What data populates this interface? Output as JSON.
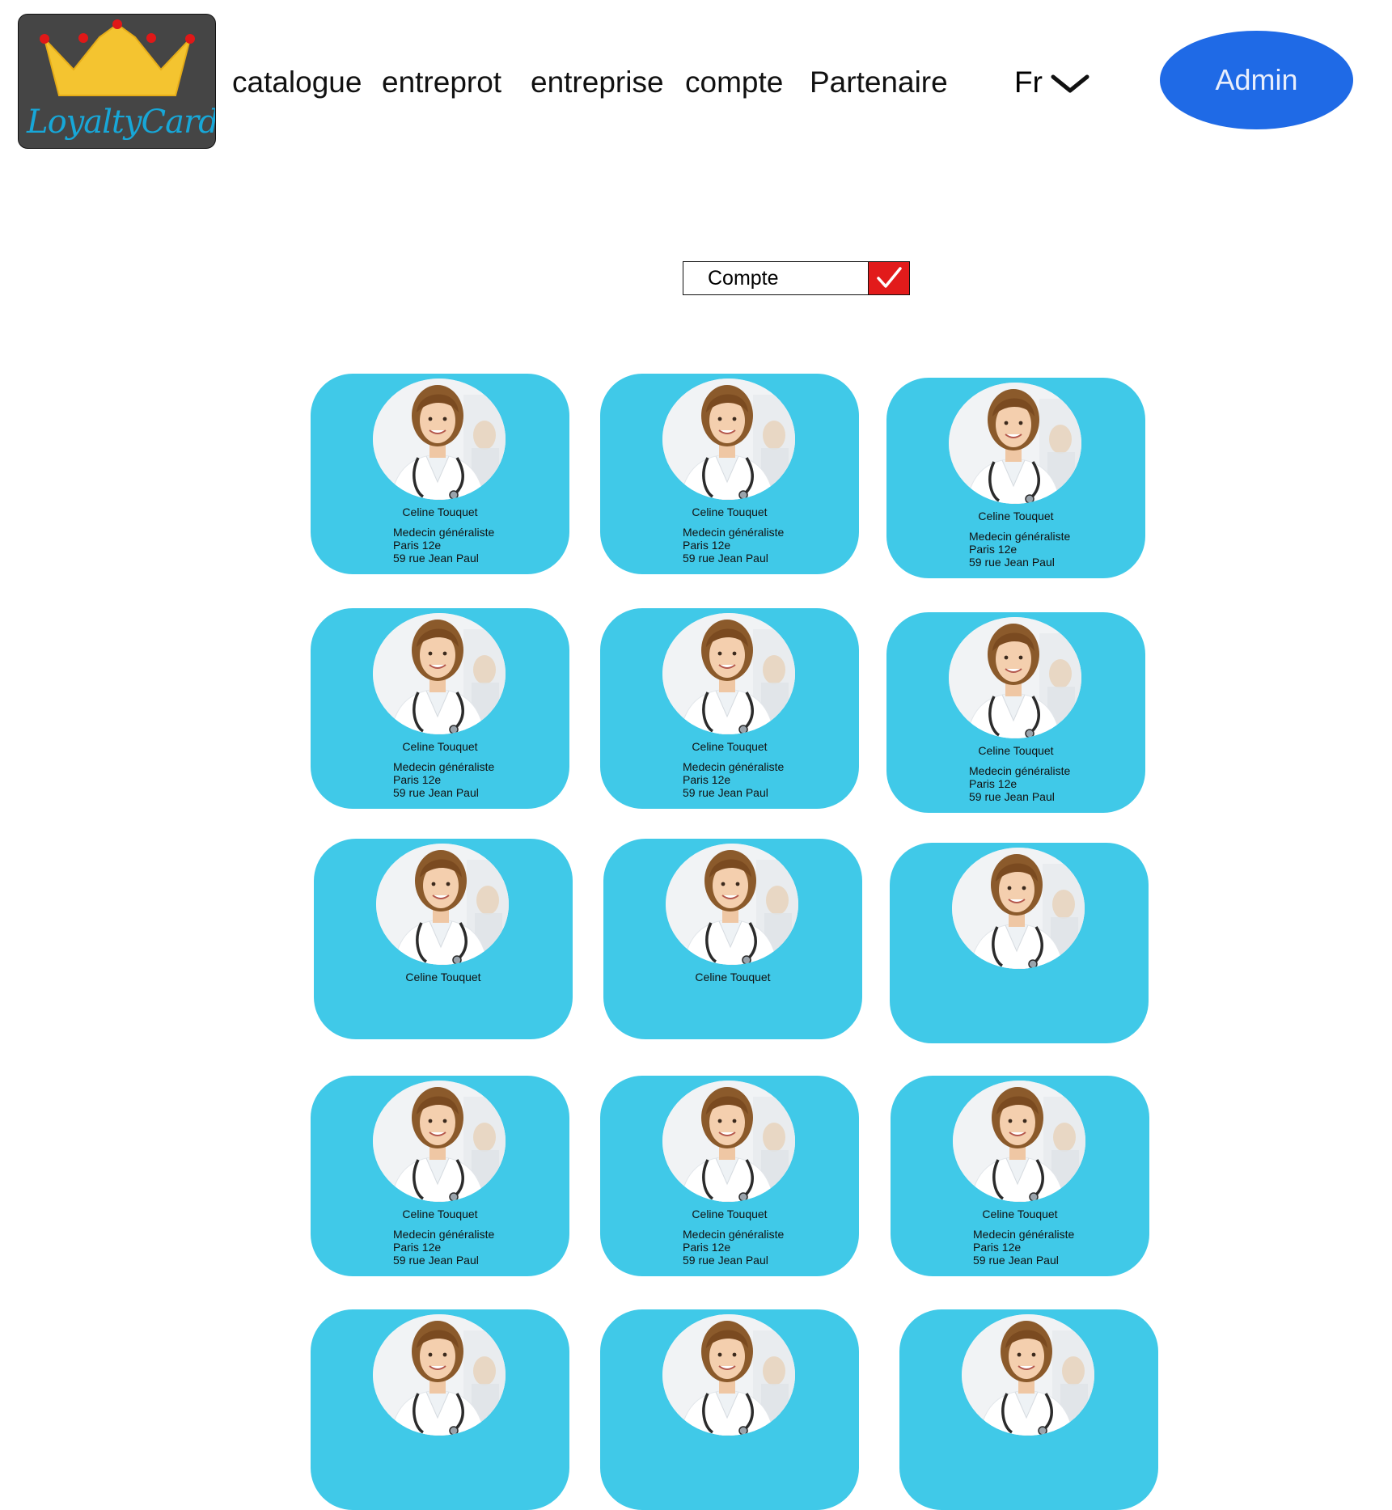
{
  "logo": {
    "text": "LoyaltyCard"
  },
  "nav": {
    "items": [
      {
        "label": "catalogue"
      },
      {
        "label": "entreprot"
      },
      {
        "label": "entreprise"
      },
      {
        "label": "compte"
      },
      {
        "label": "Partenaire"
      }
    ]
  },
  "language": {
    "selected": "Fr"
  },
  "admin_button": {
    "label": "Admin"
  },
  "filter": {
    "value": "Compte"
  },
  "cards": [
    {
      "name": "Celine Touquet",
      "specialty": "Medecin généraliste",
      "city": "Paris 12e",
      "address": "59 rue Jean Paul"
    },
    {
      "name": "Celine Touquet",
      "specialty": "Medecin généraliste",
      "city": "Paris 12e",
      "address": "59 rue Jean Paul"
    },
    {
      "name": "Celine Touquet",
      "specialty": "Medecin généraliste",
      "city": "Paris 12e",
      "address": "59 rue Jean Paul"
    },
    {
      "name": "Celine Touquet",
      "specialty": "Medecin généraliste",
      "city": "Paris 12e",
      "address": "59 rue Jean Paul"
    },
    {
      "name": "Celine Touquet",
      "specialty": "Medecin généraliste",
      "city": "Paris 12e",
      "address": "59 rue Jean Paul"
    },
    {
      "name": "Celine Touquet",
      "specialty": "Medecin généraliste",
      "city": "Paris 12e",
      "address": "59 rue Jean Paul"
    },
    {
      "name": "Celine Touquet",
      "specialty": "",
      "city": "",
      "address": ""
    },
    {
      "name": "Celine Touquet",
      "specialty": "",
      "city": "",
      "address": ""
    },
    {
      "name": "",
      "specialty": "",
      "city": "",
      "address": ""
    },
    {
      "name": "Celine Touquet",
      "specialty": "Medecin généraliste",
      "city": "Paris 12e",
      "address": "59 rue Jean Paul"
    },
    {
      "name": "Celine Touquet",
      "specialty": "Medecin généraliste",
      "city": "Paris 12e",
      "address": "59 rue Jean Paul"
    },
    {
      "name": "Celine Touquet",
      "specialty": "Medecin généraliste",
      "city": "Paris 12e",
      "address": "59 rue Jean Paul"
    },
    {
      "name": "",
      "specialty": "",
      "city": "",
      "address": ""
    },
    {
      "name": "",
      "specialty": "",
      "city": "",
      "address": ""
    },
    {
      "name": "",
      "specialty": "",
      "city": "",
      "address": ""
    }
  ],
  "colors": {
    "card_bg": "#40c9e8",
    "admin_bg": "#1f6ae6",
    "check_bg": "#e21b1b",
    "logo_bg": "#454545",
    "crown": "#f4c430"
  },
  "icons": {
    "crown": "crown-icon",
    "chevron": "chevron-down-icon",
    "check": "checkmark-icon",
    "avatar": "doctor-avatar"
  }
}
